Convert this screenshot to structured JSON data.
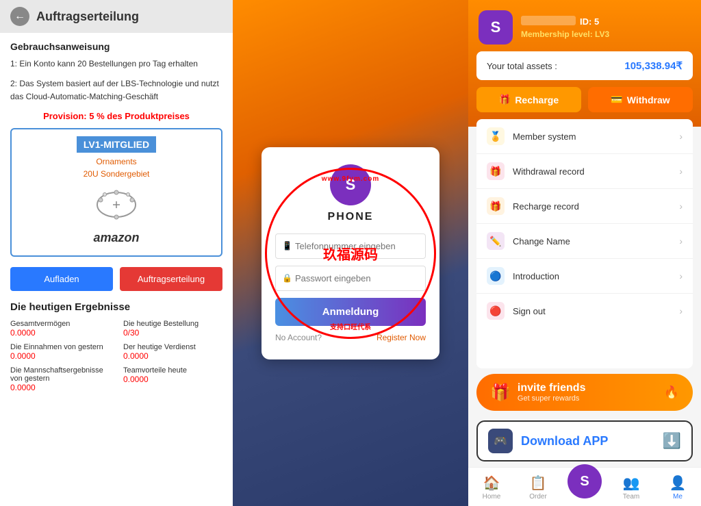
{
  "left": {
    "header": {
      "title": "Auftragserteilung",
      "back_label": "←"
    },
    "instructions": {
      "section_title": "Gebrauchsanweisung",
      "line1": "1: Ein Konto kann 20 Bestellungen pro Tag erhalten",
      "line2": "2: Das System basiert auf der LBS-Technologie und nutzt das Cloud-Automatic-Matching-Geschäft"
    },
    "provision": "Provision: 5 % des Produktpreises",
    "membership": {
      "level": "LV1-MITGLIED",
      "sub1": "Ornaments",
      "sub2": "20U Sondergebiet",
      "brand": "amazon"
    },
    "buttons": {
      "upload": "Aufladen",
      "assign": "Auftragserteilung"
    },
    "results": {
      "title": "Die heutigen Ergebnisse",
      "items": [
        {
          "label": "Gesamtvermögen",
          "value": "0.0000"
        },
        {
          "label": "Die heutige Bestellung",
          "value": "0/30"
        },
        {
          "label": "Die Einnahmen von gestern",
          "value": "0.0000"
        },
        {
          "label": "Der heutige Verdienst",
          "value": "0.0000"
        },
        {
          "label": "Die Mannschaftsergebnisse von gestern",
          "value": "0.0000"
        },
        {
          "label": "Teamvorteile heute",
          "value": "0.0000"
        }
      ]
    }
  },
  "middle": {
    "icon_letter": "S",
    "title": "PHONE",
    "phone_placeholder": "Telefonnummer eingeben",
    "password_placeholder": "Passwort eingeben",
    "login_button": "Anmeldung",
    "no_account": "No Account?",
    "register": "Register Now",
    "watermark": {
      "center": "玖福源码",
      "top": "www.9fym",
      "bottom": "支持口旺代系",
      "sub": ".com"
    }
  },
  "right": {
    "profile": {
      "avatar_letter": "S",
      "id_label": "ID: 5",
      "level": "Membership level: LV3"
    },
    "assets": {
      "label": "Your total assets :",
      "value": "105,338.94₹"
    },
    "buttons": {
      "recharge": "Recharge",
      "withdraw": "Withdraw"
    },
    "menu": [
      {
        "label": "Member system",
        "icon": "🏅",
        "color": "#f5a623"
      },
      {
        "label": "Withdrawal record",
        "icon": "🎁",
        "color": "#e91e8c"
      },
      {
        "label": "Recharge record",
        "icon": "🎁",
        "color": "#ff9800"
      },
      {
        "label": "Change Name",
        "icon": "✏️",
        "color": "#9c27b0"
      },
      {
        "label": "Introduction",
        "icon": "🔵",
        "color": "#2196f3"
      },
      {
        "label": "Sign out",
        "icon": "🔴",
        "color": "#f44336"
      }
    ],
    "invite": {
      "main": "invite friends",
      "sub": "Get super rewards"
    },
    "download": {
      "label": "Download APP"
    },
    "nav": [
      {
        "label": "Home",
        "icon": "🏠",
        "active": false
      },
      {
        "label": "Order",
        "icon": "📋",
        "active": false
      },
      {
        "label": "",
        "icon": "S",
        "active": false,
        "center": true
      },
      {
        "label": "Team",
        "icon": "👥",
        "active": false
      },
      {
        "label": "Me",
        "icon": "👤",
        "active": true
      }
    ]
  }
}
